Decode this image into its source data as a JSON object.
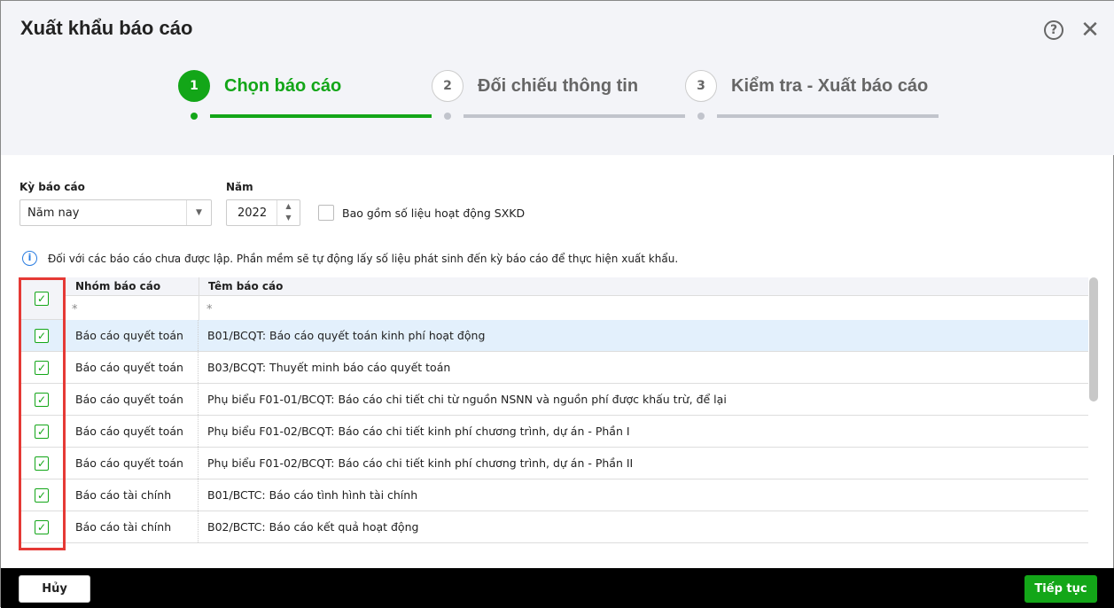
{
  "title": "Xuất khẩu báo cáo",
  "steps": [
    {
      "num": "1",
      "label": "Chọn báo cáo"
    },
    {
      "num": "2",
      "label": "Đối chiếu thông tin"
    },
    {
      "num": "3",
      "label": "Kiểm tra - Xuất báo cáo"
    }
  ],
  "filters": {
    "period_label": "Kỳ báo cáo",
    "period_value": "Năm nay",
    "year_label": "Năm",
    "year_value": "2022",
    "include_label": "Bao gồm số liệu hoạt động SXKD"
  },
  "info": "Đối với các báo cáo chưa được lập. Phần mềm sẽ tự động lấy số liệu phát sinh đến kỳ báo cáo để thực hiện xuất khẩu.",
  "grid": {
    "col_group": "Nhóm báo cáo",
    "col_name": "Têm báo cáo",
    "filter_symbol": "*",
    "rows": [
      {
        "group": "Báo cáo quyết toán",
        "name": "B01/BCQT: Báo cáo quyết toán kinh phí hoạt động"
      },
      {
        "group": "Báo cáo quyết toán",
        "name": "B03/BCQT: Thuyết minh báo cáo quyết toán"
      },
      {
        "group": "Báo cáo quyết toán",
        "name": "Phụ biểu F01-01/BCQT: Báo cáo chi tiết chi từ nguồn NSNN và nguồn phí được khấu trừ, để lại"
      },
      {
        "group": "Báo cáo quyết toán",
        "name": "Phụ biểu F01-02/BCQT: Báo cáo chi tiết kinh phí chương trình, dự án - Phần I"
      },
      {
        "group": "Báo cáo quyết toán",
        "name": "Phụ biểu F01-02/BCQT: Báo cáo chi tiết kinh phí chương trình, dự án - Phần II"
      },
      {
        "group": "Báo cáo tài chính",
        "name": "B01/BCTC: Báo cáo tình hình tài chính"
      },
      {
        "group": "Báo cáo tài chính",
        "name": "B02/BCTC: Báo cáo kết quả hoạt động"
      }
    ]
  },
  "footer": {
    "cancel": "Hủy",
    "next": "Tiếp tục"
  }
}
